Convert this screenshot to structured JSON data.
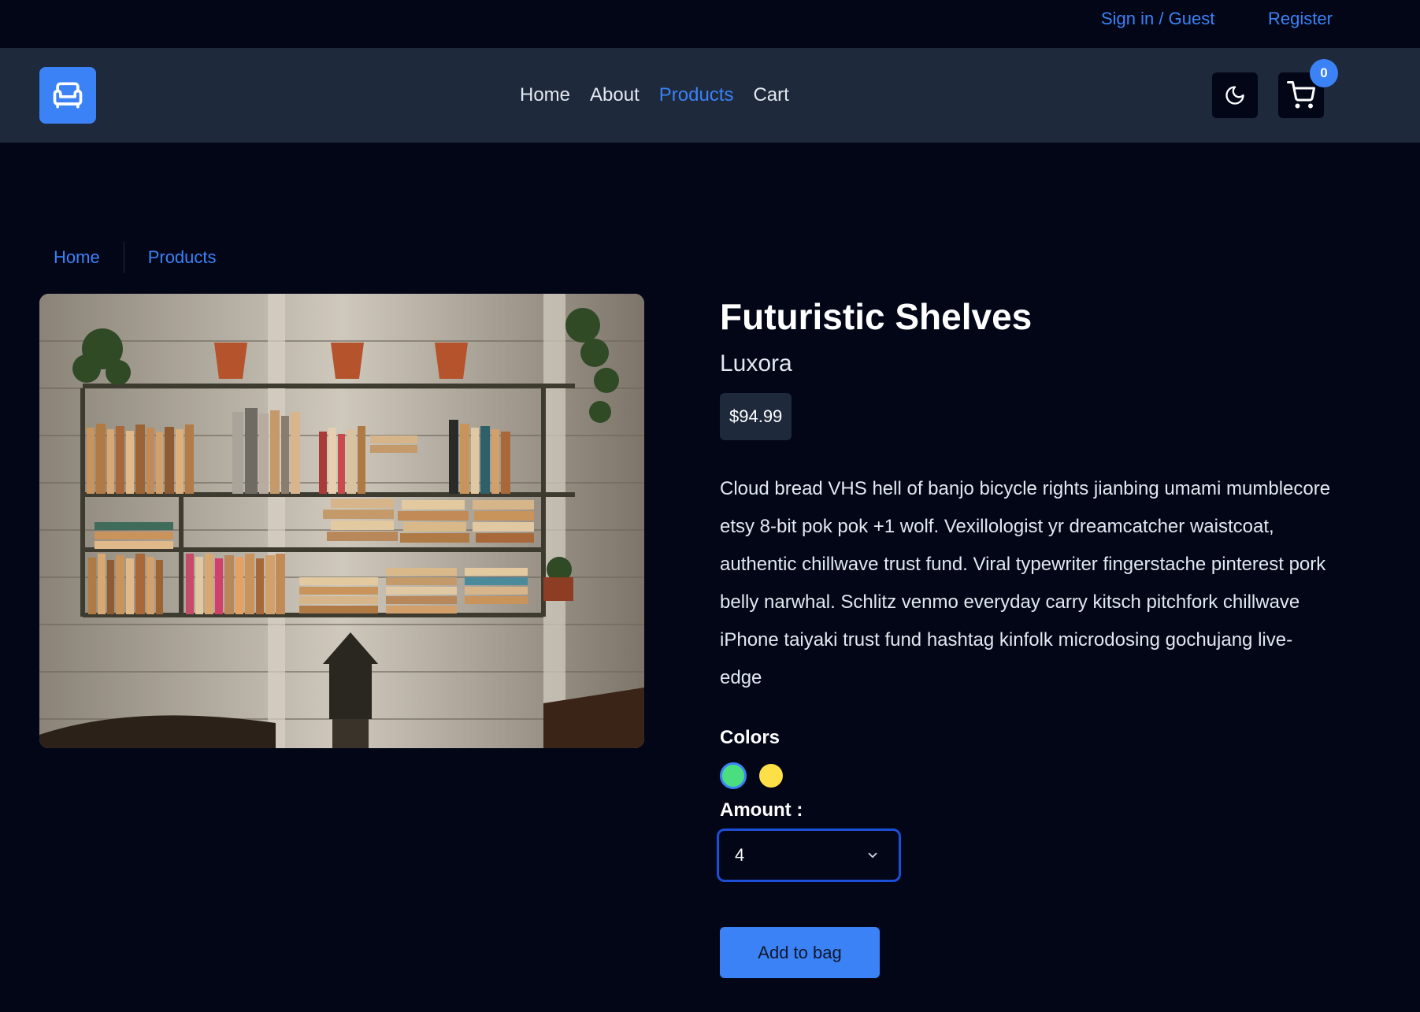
{
  "topbar": {
    "signin_label": "Sign in / Guest",
    "register_label": "Register"
  },
  "nav": {
    "links": [
      {
        "label": "Home"
      },
      {
        "label": "About"
      },
      {
        "label": "Products"
      },
      {
        "label": "Cart"
      }
    ],
    "active": "Products",
    "cart_count": "0"
  },
  "breadcrumb": {
    "items": [
      "Home",
      "Products"
    ]
  },
  "product": {
    "title": "Futuristic Shelves",
    "company": "Luxora",
    "price": "$94.99",
    "description": "Cloud bread VHS hell of banjo bicycle rights jianbing umami mumblecore etsy 8-bit pok pok +1 wolf. Vexillologist yr dreamcatcher waistcoat, authentic chillwave trust fund. Viral typewriter fingerstache pinterest pork belly narwhal. Schlitz venmo everyday carry kitsch pitchfork chillwave iPhone taiyaki trust fund hashtag kinfolk microdosing gochujang live-edge",
    "colors_label": "Colors",
    "colors": [
      "#4ade80",
      "#fde047"
    ],
    "amount_label": "Amount :",
    "amount_value": "4",
    "add_button_label": "Add to bag"
  },
  "theme": {
    "accent": "#3b82f6",
    "background": "#020617",
    "navbar_bg": "#1e293b"
  },
  "icons": {
    "logo": "armchair-icon",
    "theme_toggle": "moon-icon",
    "cart": "cart-icon",
    "select": "chevron-down-icon"
  }
}
